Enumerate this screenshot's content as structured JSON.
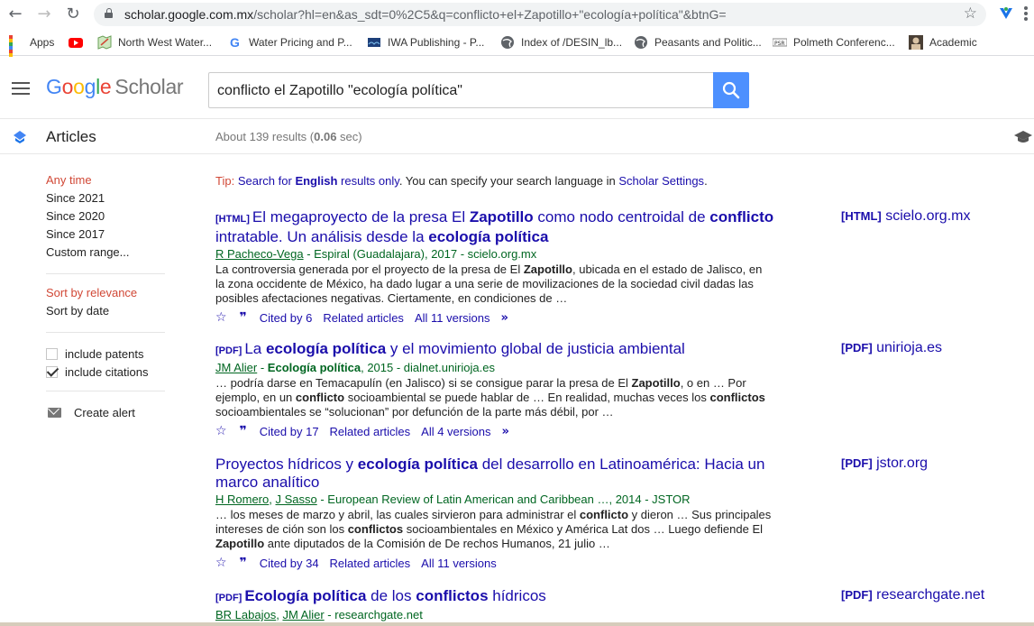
{
  "browser": {
    "url_host": "scholar.google.com.mx",
    "url_path": "/scholar?hl=en&as_sdt=0%2C5&q=conflicto+el+Zapotillo+\"ecología+política\"&btnG=",
    "bookmarks": [
      {
        "label": "Apps",
        "icon": "apps-grid-icon"
      },
      {
        "label": "",
        "icon": "youtube-icon"
      },
      {
        "label": "North West Water...",
        "icon": "map-icon"
      },
      {
        "label": "Water Pricing and P...",
        "icon": "google-icon"
      },
      {
        "label": "IWA Publishing - P...",
        "icon": "iwa-icon"
      },
      {
        "label": "Index of /DESIN_lb...",
        "icon": "globe-icon"
      },
      {
        "label": "Peasants and Politic...",
        "icon": "globe-icon"
      },
      {
        "label": "Polmeth Conferenc...",
        "icon": "psr-icon"
      },
      {
        "label": "Academic",
        "icon": "portrait-icon"
      }
    ]
  },
  "header": {
    "logo_google": "Google",
    "logo_scholar": "Scholar",
    "query": "conflicto el Zapotillo \"ecología política\""
  },
  "subbar": {
    "section": "Articles",
    "results_prefix": "About 139 results (",
    "results_time": "0.06",
    "results_suffix": " sec)"
  },
  "sidebar": {
    "time_filters": [
      "Any time",
      "Since 2021",
      "Since 2020",
      "Since 2017",
      "Custom range..."
    ],
    "sort_options": [
      "Sort by relevance",
      "Sort by date"
    ],
    "include_patents": "include patents",
    "include_citations": "include citations",
    "create_alert": "Create alert"
  },
  "tip": {
    "label": "Tip:",
    "text1": "Search for",
    "english": "English",
    "text2": "results only",
    "text3": ". You can specify your search language in",
    "settings": "Scholar Settings",
    "text4": "."
  },
  "results": [
    {
      "tag": "[HTML]",
      "title_parts": [
        "El megaproyecto de la presa El ",
        "Zapotillo",
        " como nodo centroidal de ",
        "conflicto",
        " intratable. Un análisis desde la ",
        "ecología política"
      ],
      "authors": [
        "R Pacheco-Vega"
      ],
      "meta_rest": " - Espiral (Guadalajara), 2017 - scielo.org.mx",
      "snippet_parts": [
        "La controversia generada por el proyecto de la presa de El ",
        "Zapotillo",
        ", ubicada en el estado de Jalisco, en la zona occidente de México, ha dado lugar a una serie de movilizaciones de la sociedad civil dadas las posibles afectaciones negativas. Ciertamente, en condiciones de …"
      ],
      "cited_by": "Cited by 6",
      "related": "Related articles",
      "versions": "All 11 versions",
      "side_tag": "[HTML]",
      "side_domain": "scielo.org.mx"
    },
    {
      "tag": "[PDF]",
      "title_parts": [
        "La ",
        "ecología política",
        " y el movimiento global de justicia ambiental"
      ],
      "authors": [
        "JM Alier"
      ],
      "meta_rest_parts": [
        " - ",
        "Ecología política",
        ", 2015 - dialnet.unirioja.es"
      ],
      "snippet_parts": [
        "… podría darse en Temacapulín (en Jalisco) si se consigue parar la presa de El ",
        "Zapotillo",
        ", o en … Por ejemplo, en un ",
        "conflicto",
        " socioambiental se puede hablar de … En realidad, muchas veces los ",
        "conflictos",
        " socioambientales se “solucionan” por defunción de la parte más débil, por …"
      ],
      "cited_by": "Cited by 17",
      "related": "Related articles",
      "versions": "All 4 versions",
      "side_tag": "[PDF]",
      "side_domain": "unirioja.es"
    },
    {
      "tag": "",
      "title_parts": [
        "Proyectos hídricos y ",
        "ecología política",
        " del desarrollo en Latinoamérica: Hacia un marco analítico"
      ],
      "authors": [
        "H Romero",
        "J Sasso"
      ],
      "meta_rest": " - European Review of Latin American and Caribbean …, 2014 - JSTOR",
      "snippet_parts": [
        "… los meses de marzo y abril, las cuales sirvieron para administrar el ",
        "conflicto",
        " y dieron … Sus principales intereses de ción son los ",
        "conflictos",
        " socioambientales en México y América Lat dos … Luego defiende El ",
        "Zapotillo",
        " ante diputados de la Comisión de De rechos Humanos, 21 julio …"
      ],
      "cited_by": "Cited by 34",
      "related": "Related articles",
      "versions": "All 11 versions",
      "side_tag": "[PDF]",
      "side_domain": "jstor.org"
    },
    {
      "tag": "[PDF]",
      "title_parts": [
        "Ecología política",
        " de los ",
        "conflictos",
        " hídricos"
      ],
      "authors": [
        "BR Labajos",
        "JM Alier"
      ],
      "meta_rest": " - researchgate.net",
      "side_tag": "[PDF]",
      "side_domain": "researchgate.net"
    }
  ],
  "icons": {
    "back": "back-arrow-icon",
    "forward": "forward-arrow-icon",
    "reload": "reload-icon",
    "star": "star-icon",
    "quote": "quote-icon",
    "more": "double-chevron-icon"
  },
  "colors": {
    "link": "#1a0dab",
    "meta_green": "#006621",
    "accent_red": "#d14836",
    "search_blue": "#4d90fe"
  }
}
